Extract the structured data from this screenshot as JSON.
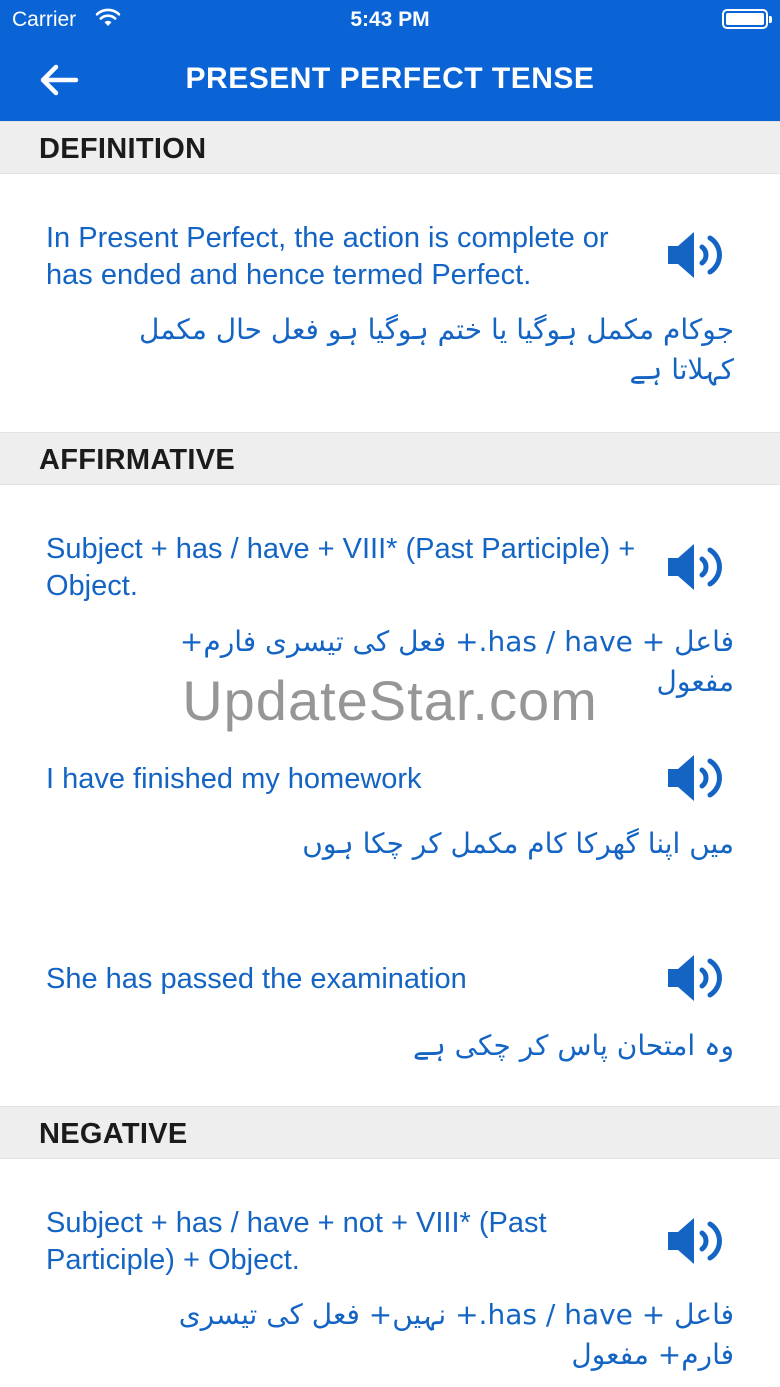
{
  "status_bar": {
    "carrier": "Carrier",
    "time": "5:43 PM"
  },
  "nav": {
    "title": "PRESENT PERFECT TENSE",
    "back_icon": "arrow-left-icon"
  },
  "sections": {
    "definition": {
      "header": "DEFINITION",
      "english": "In Present Perfect, the action is complete or has ended and hence termed Perfect.",
      "urdu": "جوکام مکمل ہوگیا یا ختم ہوگیا ہو فعل حال مکمل کہلاتا ہے"
    },
    "affirmative": {
      "header": "AFFIRMATIVE",
      "rule_english": "Subject + has / have +  VIII* (Past Participle) + Object.",
      "rule_urdu": "فاعل + has / have.+  فعل کی تیسری فارم+ مفعول",
      "example1_english": "I have finished my homework",
      "example1_urdu": "میں  اپنا گھرکا کام مکمل کر چکا ہوں",
      "example2_english": "She has passed the examination",
      "example2_urdu": "وہ امتحان پاس کر چکی ہے"
    },
    "negative": {
      "header": "NEGATIVE",
      "rule_english": "Subject + has / have + not + VIII* (Past Participle) + Object.",
      "rule_urdu": "فاعل + has / have.+ نہیں+  فعل کی تیسری فارم+ مفعول"
    }
  },
  "watermark": "UpdateStar.com",
  "colors": {
    "bar": "#0a64d6",
    "text_accent": "#1464c4",
    "section_bg": "#eeeeee"
  },
  "icons": {
    "speaker": "speaker-icon",
    "wifi": "wifi-icon",
    "battery": "battery-icon"
  }
}
